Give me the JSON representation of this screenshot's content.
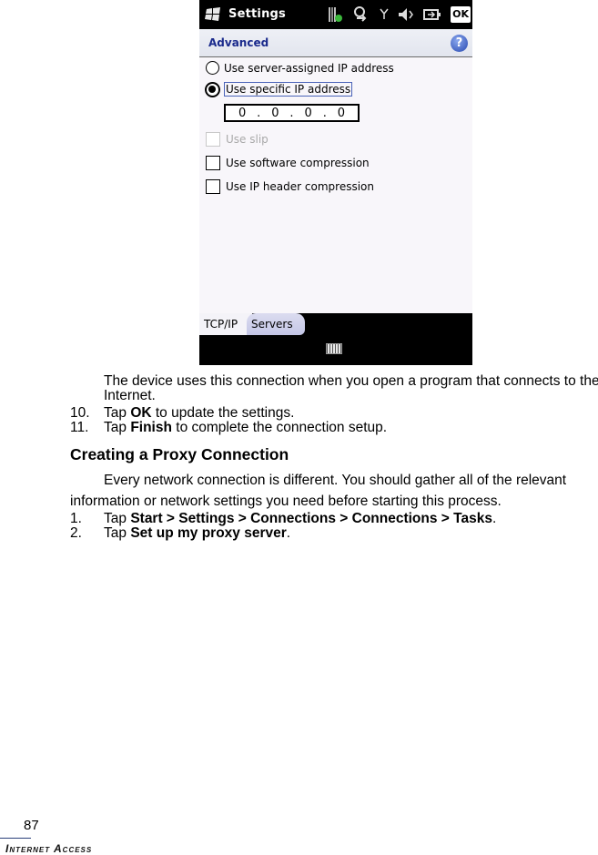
{
  "screenshot": {
    "titlebar": {
      "title": "Settings",
      "ok_label": "OK",
      "status_icons": [
        "signal-bars-icon",
        "connectivity-icon",
        "antenna-icon",
        "speaker-muted-icon",
        "battery-charging-icon"
      ]
    },
    "subheader": {
      "title": "Advanced",
      "help_label": "?"
    },
    "options": {
      "server_assigned": {
        "label": "Use server-assigned IP address",
        "checked": false
      },
      "specific": {
        "label": "Use specific IP address",
        "checked": true
      },
      "ip_octets": [
        "0",
        "0",
        "0",
        "0"
      ],
      "use_slip": {
        "label": "Use slip",
        "checked": false,
        "disabled": true
      },
      "software_compression": {
        "label": "Use software compression",
        "checked": false
      },
      "ip_header_compression": {
        "label": "Use IP header compression",
        "checked": false
      }
    },
    "tabs": [
      {
        "label": "TCP/IP",
        "active": true
      },
      {
        "label": "Servers",
        "active": false
      }
    ]
  },
  "document": {
    "intro": "The device uses this connection when you open a program that connects to the Internet.",
    "steps_a": [
      {
        "num": "10.",
        "pre": "Tap ",
        "bold": "OK",
        "post": " to update the settings."
      },
      {
        "num": "11.",
        "pre": "Tap ",
        "bold": "Finish",
        "post": " to complete the connection setup."
      }
    ],
    "heading": "Creating a Proxy Connection",
    "body_line1": "Every network connection is different. You should gather all of the relevant",
    "body_line2": "information or network settings you need before starting this process.",
    "steps_b": [
      {
        "num": "1.",
        "pre": "Tap ",
        "bold": "Start > Settings > Connections > Connections > Tasks",
        "post": "."
      },
      {
        "num": "2.",
        "pre": "Tap ",
        "bold": "Set up my proxy server",
        "post": "."
      }
    ]
  },
  "footer": {
    "page_number": "87",
    "section": "Internet Access"
  }
}
